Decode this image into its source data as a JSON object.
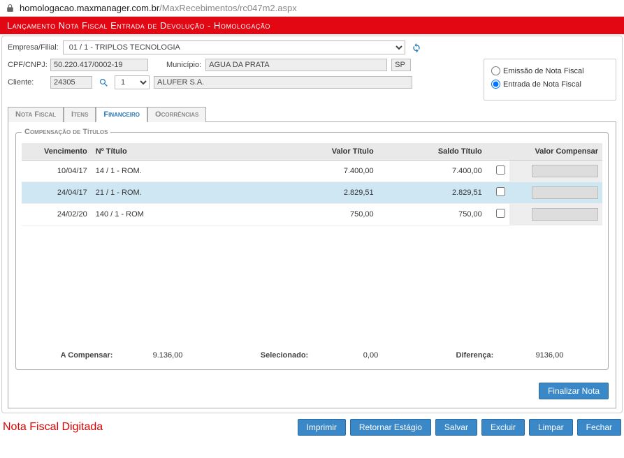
{
  "url": {
    "domain": "homologacao.maxmanager.com.br",
    "path": "/MaxRecebimentos/rc047m2.aspx"
  },
  "title": "Lançamento Nota Fiscal Entrada de Devolução   - Homologação",
  "form": {
    "empresa_label": "Empresa/Filial:",
    "empresa_value": "01 / 1 - TRIPLOS TECNOLOGIA",
    "cpf_label": "CPF/CNPJ:",
    "cpf_value": "50.220.417/0002-19",
    "municipio_label": "Município:",
    "municipio_value": "AGUA DA PRATA",
    "uf_value": "SP",
    "cliente_label": "Cliente:",
    "cliente_codigo": "24305",
    "cliente_seq": "1",
    "cliente_nome": "ALUFER S.A."
  },
  "radio": {
    "emissao_label": "Emissão de Nota Fiscal",
    "entrada_label": "Entrada de Nota Fiscal"
  },
  "tabs": {
    "nota_fiscal": "Nota Fiscal",
    "itens": "Itens",
    "financeiro": "Financeiro",
    "ocorrencias": "Ocorrências"
  },
  "fieldset_legend": "Compensação de Títulos",
  "grid": {
    "headers": {
      "vencimento": "Vencimento",
      "titulo": "Nº Título",
      "valor": "Valor Título",
      "saldo": "Saldo Título",
      "compensar": "Valor Compensar"
    },
    "rows": [
      {
        "vencimento": "10/04/17",
        "titulo": "14 / 1 - ROM.",
        "valor": "7.400,00",
        "saldo": "7.400,00",
        "checked": false
      },
      {
        "vencimento": "24/04/17",
        "titulo": "21 / 1 - ROM.",
        "valor": "2.829,51",
        "saldo": "2.829,51",
        "checked": false,
        "highlight": true
      },
      {
        "vencimento": "24/02/20",
        "titulo": "140 / 1 - ROM",
        "valor": "750,00",
        "saldo": "750,00",
        "checked": false
      }
    ]
  },
  "totals": {
    "a_compensar_label": "A Compensar:",
    "a_compensar_value": "9.136,00",
    "selecionado_label": "Selecionado:",
    "selecionado_value": "0,00",
    "diferenca_label": "Diferença:",
    "diferenca_value": "9136,00"
  },
  "buttons": {
    "finalizar": "Finalizar Nota",
    "imprimir": "Imprimir",
    "retornar": "Retornar Estágio",
    "salvar": "Salvar",
    "excluir": "Excluir",
    "limpar": "Limpar",
    "fechar": "Fechar"
  },
  "status": "Nota Fiscal Digitada",
  "chart_data": {
    "type": "table",
    "title": "Compensação de Títulos",
    "columns": [
      "Vencimento",
      "Nº Título",
      "Valor Título",
      "Saldo Título"
    ],
    "rows": [
      [
        "10/04/17",
        "14 / 1 - ROM.",
        7400.0,
        7400.0
      ],
      [
        "24/04/17",
        "21 / 1 - ROM.",
        2829.51,
        2829.51
      ],
      [
        "24/02/20",
        "140 / 1 - ROM",
        750.0,
        750.0
      ]
    ],
    "totals": {
      "A Compensar": 9136.0,
      "Selecionado": 0.0,
      "Diferença": 9136.0
    }
  }
}
